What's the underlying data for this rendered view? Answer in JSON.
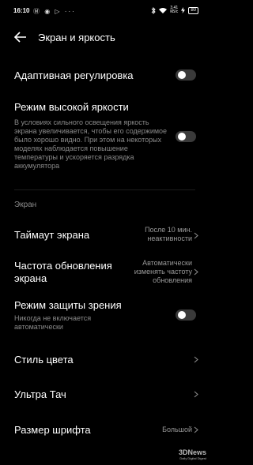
{
  "status_bar": {
    "time": "16:10",
    "left_icons": "Ⓜ ◉ ▷ ···",
    "net_speed_top": "3.41",
    "net_speed_bottom": "КБ/с",
    "battery": "80"
  },
  "header": {
    "title": "Экран и яркость",
    "back_icon": "arrow-left-icon"
  },
  "items": {
    "adaptive": {
      "label": "Адаптивная регулировка",
      "toggle_on": false
    },
    "high_brightness": {
      "label": "Режим высокой яркости",
      "description": "В условиях сильного освещения яркость экрана увеличивается, чтобы его содержимое было хорошо видно. При этом на некоторых моделях наблюдается повышение температуры и ускоряется разрядка аккумулятора",
      "toggle_on": false
    },
    "section_title": "Экран",
    "timeout": {
      "label": "Таймаут экрана",
      "value_line1": "После 10 мин.",
      "value_line2": "неактивности"
    },
    "refresh": {
      "label_line1": "Частота обновления",
      "label_line2": "экрана",
      "value_line1": "Автоматически",
      "value_line2": "изменять частоту",
      "value_line3": "обновления"
    },
    "eye": {
      "label": "Режим защиты зрения",
      "description_line1": "Никогда не включается",
      "description_line2": "автоматически",
      "toggle_on": false
    },
    "color_style": {
      "label": "Стиль цвета"
    },
    "ultra_touch": {
      "label": "Ультра Тач"
    },
    "font_size": {
      "label": "Размер шрифта",
      "value": "Большой"
    }
  },
  "watermark": {
    "line1": "3DNews",
    "line2": "Daily Digital Digest"
  }
}
